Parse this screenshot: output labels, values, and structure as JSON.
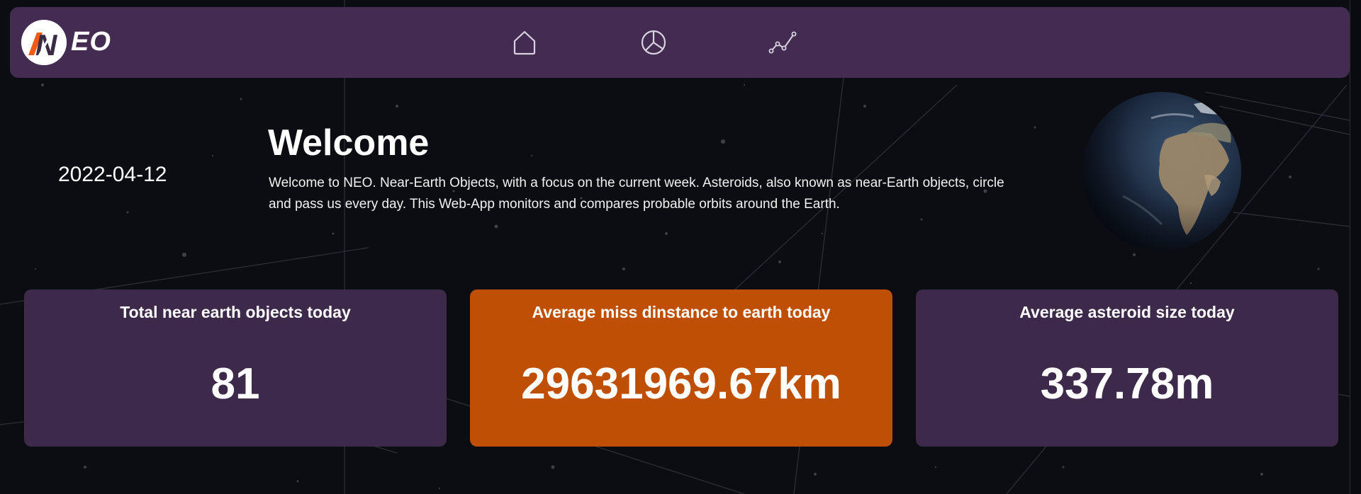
{
  "brand": {
    "logo_letter": "N",
    "logo_text": "EO"
  },
  "nav": {
    "items": [
      {
        "icon": "home-icon"
      },
      {
        "icon": "pie-chart-icon"
      },
      {
        "icon": "line-chart-icon"
      }
    ]
  },
  "hero": {
    "date": "2022-04-12",
    "title": "Welcome",
    "text": "Welcome to NEO. Near-Earth Objects, with a focus on the current week. Asteroids, also known as near-Earth objects, circle and pass us every day. This Web-App monitors and compares probable orbits around the Earth."
  },
  "stats": [
    {
      "title": "Total near earth objects today",
      "value": "81"
    },
    {
      "title": "Average miss dinstance to earth today",
      "value": "29631969.67km"
    },
    {
      "title": "Average asteroid size today",
      "value": "337.78m"
    }
  ],
  "colors": {
    "navbar": "#432b51",
    "card": "#3d2a4b",
    "accent_card": "#c04f06",
    "logo_accent": "#f05a14",
    "background": "#0c0d12"
  }
}
